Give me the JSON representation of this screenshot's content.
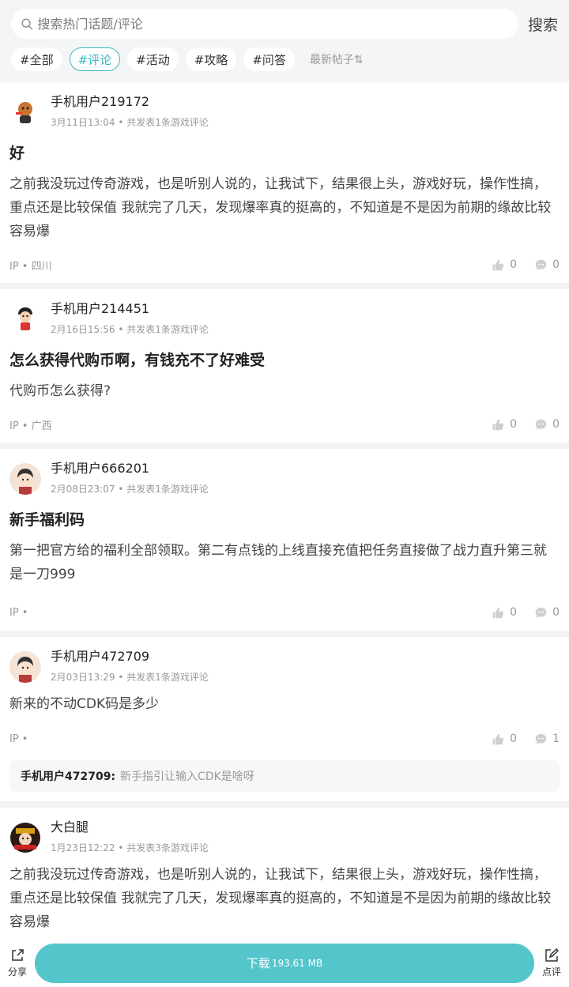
{
  "search": {
    "placeholder": "搜索热门话题/评论",
    "button": "搜索"
  },
  "tags": [
    "#全部",
    "#评论",
    "#活动",
    "#攻略",
    "#问答"
  ],
  "active_tag_index": 1,
  "sort_label": "最新帖子⇅",
  "colors": {
    "accent": "#3ab9c4",
    "download_button": "#55c5cc"
  },
  "posts": [
    {
      "user": "手机用户219172",
      "date": "3月11日13:04",
      "meta_suffix": "• 共发表1条游戏评论",
      "title": "好",
      "content": "之前我没玩过传奇游戏，也是听别人说的，让我试下，结果很上头，游戏好玩，操作性搞，重点还是比较保值 我就完了几天，发现爆率真的挺高的，不知道是不是因为前期的缘故比较容易爆",
      "ip": "IP • 四川",
      "likes": "0",
      "comments": "0"
    },
    {
      "user": "手机用户214451",
      "date": "2月16日15:56",
      "meta_suffix": "• 共发表1条游戏评论",
      "title": "怎么获得代购币啊，有钱充不了好难受",
      "content": "代购币怎么获得?",
      "ip": "IP • 广西",
      "likes": "0",
      "comments": "0"
    },
    {
      "user": "手机用户666201",
      "date": "2月08日23:07",
      "meta_suffix": "• 共发表1条游戏评论",
      "title": "新手福利码",
      "content": "第一把官方给的福利全部领取。第二有点钱的上线直接充值把任务直接做了战力直升第三就是一刀999",
      "ip": "IP •",
      "likes": "0",
      "comments": "0"
    },
    {
      "user": "手机用户472709",
      "date": "2月03日13:29",
      "meta_suffix": "• 共发表1条游戏评论",
      "content": "新来的不动CDK码是多少",
      "ip": "IP •",
      "likes": "0",
      "comments": "1",
      "reply_user": "手机用户472709:",
      "reply_text": "新手指引让输入CDK是啥呀"
    },
    {
      "user": "大白腿",
      "date": "1月23日12:22",
      "meta_suffix": "• 共发表3条游戏评论",
      "content": "之前我没玩过传奇游戏，也是听别人说的，让我试下，结果很上头，游戏好玩，操作性搞，重点还是比较保值 我就完了几天，发现爆率真的挺高的，不知道是不是因为前期的缘故比较容易爆"
    }
  ],
  "bottom": {
    "share": "分享",
    "download": "下载",
    "size": "193.61 MB",
    "review": "点评"
  }
}
